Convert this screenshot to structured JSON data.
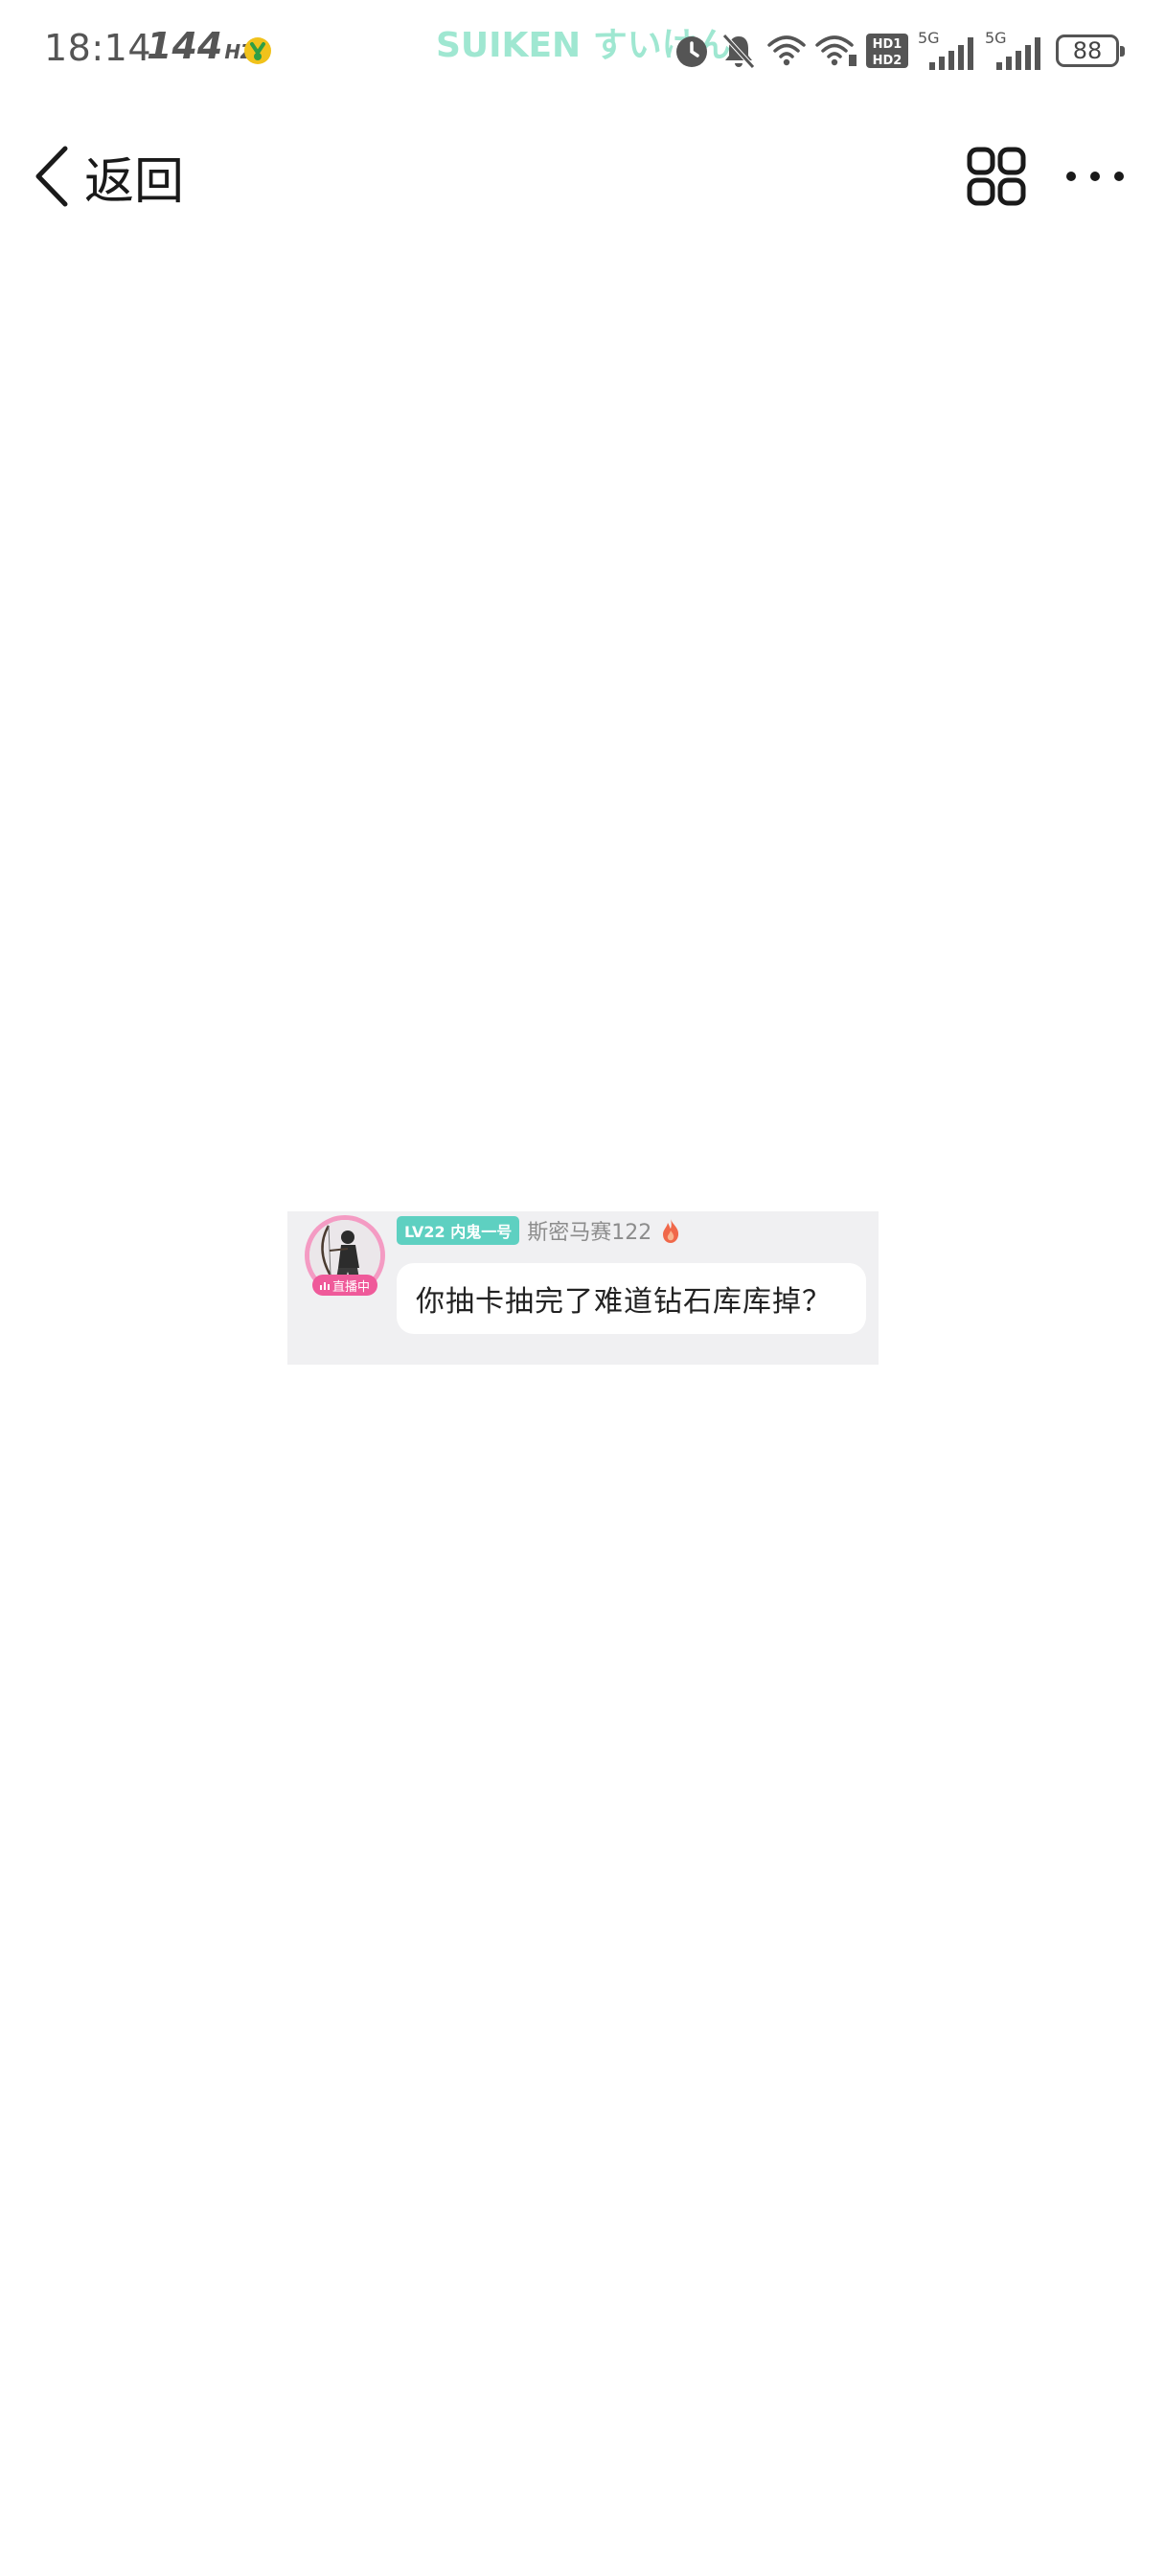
{
  "status_bar": {
    "time": "18:14",
    "refresh_rate": "144",
    "refresh_unit": "HZ",
    "watermark": "SUIKEN すいけん",
    "hd1_label": "HD1",
    "hd2_label": "HD2",
    "sim1_type": "5G",
    "sim2_type": "5G",
    "battery": "88",
    "icons": [
      "app-notification-icon",
      "alarm-icon",
      "bell-muted-icon",
      "wifi-icon",
      "wifi-calling-icon",
      "hd-icon",
      "signal-icon",
      "signal-icon",
      "battery-icon"
    ]
  },
  "nav": {
    "back_label": "返回",
    "icons": [
      "chevron-left-icon",
      "grid-icon",
      "more-icon"
    ]
  },
  "comment": {
    "live_label": "直播中",
    "fan_badge": "LV22 内鬼一号",
    "username": "斯密马赛122",
    "message": "你抽卡抽完了难道钻石库库掉？",
    "colors": {
      "card_background": "#f0f0f2",
      "fan_badge": "#5ed0c1",
      "live_badge": "#ef5a9a",
      "avatar_ring": "#f49bc3"
    }
  }
}
